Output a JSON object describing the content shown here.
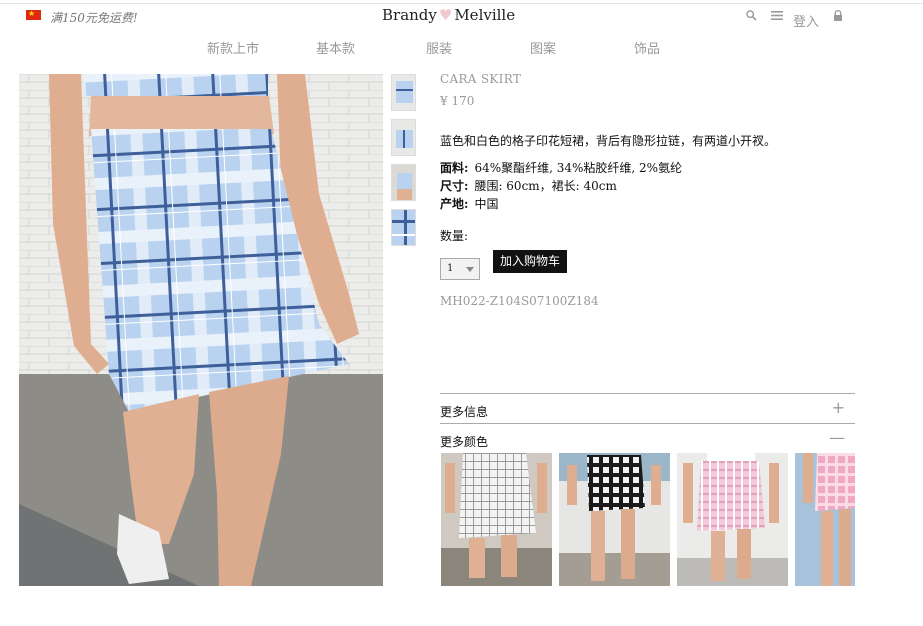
{
  "header": {
    "promo": "满150元免运费!",
    "brand_left": "Brandy",
    "brand_right": "Melville",
    "login": "登入"
  },
  "nav": {
    "items": [
      {
        "label": "新款上市"
      },
      {
        "label": "基本款"
      },
      {
        "label": "服装"
      },
      {
        "label": "图案"
      },
      {
        "label": "饰品"
      }
    ]
  },
  "product": {
    "name": "CARA SKIRT",
    "price": "¥ 170",
    "description": "蓝色和白色的格子印花短裙，背后有隐形拉链，有两道小开衩。",
    "specs": [
      {
        "label": "面料:",
        "value": "64%聚酯纤维, 34%粘胶纤维, 2%氨纶"
      },
      {
        "label": "尺寸:",
        "value": "腰围: 60cm，裙长: 40cm"
      },
      {
        "label": "产地:",
        "value": "中国"
      }
    ],
    "qty_label": "数量:",
    "qty_value": "1",
    "add_to_cart": "加入购物车",
    "sku": "MH022-Z104S07100Z184"
  },
  "accordion": {
    "more_info": "更多信息",
    "more_info_sign": "+",
    "more_colors": "更多颜色",
    "more_colors_sign": "—"
  },
  "colors": {
    "accent": "#111111",
    "muted": "#999999",
    "flag": "#de2910"
  }
}
